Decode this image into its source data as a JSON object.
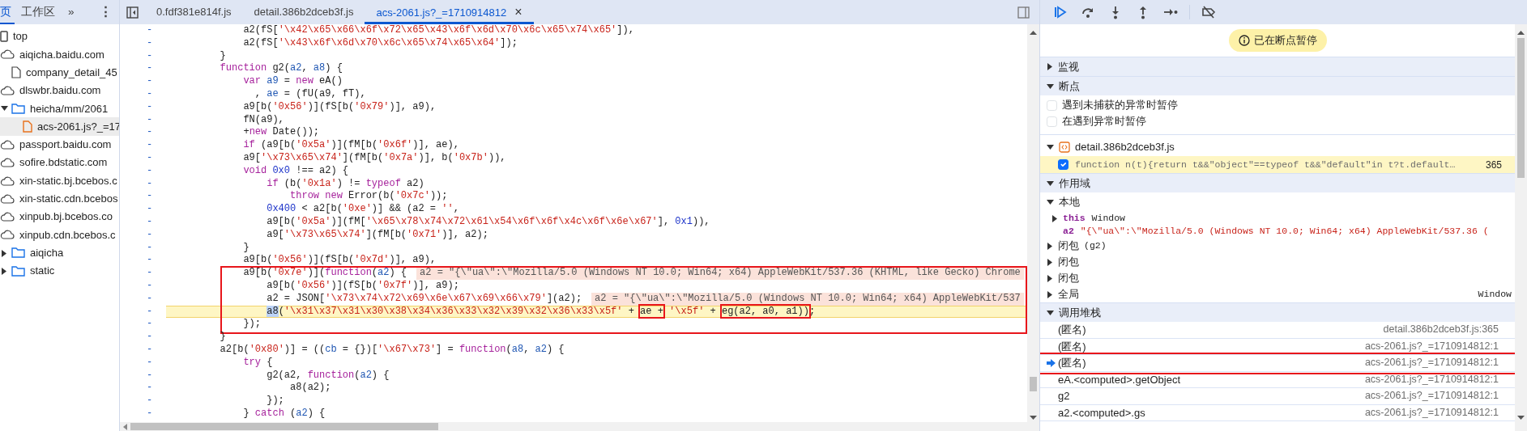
{
  "sidebar": {
    "tabs": [
      {
        "label": "页",
        "selected": true
      },
      {
        "label": "工作区",
        "selected": false
      }
    ],
    "more": "»",
    "menu": "⋮",
    "tree": [
      {
        "label": "top",
        "kind": "frame",
        "selected": false
      },
      {
        "label": "aiqicha.baidu.com",
        "kind": "domain",
        "selected": false,
        "children": [
          {
            "label": "company_detail_45",
            "kind": "file",
            "selected": false
          }
        ]
      },
      {
        "label": "dlswbr.baidu.com",
        "kind": "domain",
        "selected": false,
        "children": [
          {
            "label": "heicha/mm/2061",
            "kind": "folder",
            "expanded": true,
            "selected": false,
            "children": [
              {
                "label": "acs-2061.js?_=17",
                "kind": "script",
                "selected": true
              }
            ]
          }
        ]
      },
      {
        "label": "passport.baidu.com",
        "kind": "domain",
        "selected": false
      },
      {
        "label": "sofire.bdstatic.com",
        "kind": "domain",
        "selected": false
      },
      {
        "label": "xin-static.bj.bcebos.c",
        "kind": "domain",
        "selected": false
      },
      {
        "label": "xin-static.cdn.bcebos",
        "kind": "domain",
        "selected": false
      },
      {
        "label": "xinpub.bj.bcebos.co",
        "kind": "domain",
        "selected": false
      },
      {
        "label": "xinpub.cdn.bcebos.c",
        "kind": "domain",
        "selected": false,
        "children": [
          {
            "label": "aiqicha",
            "kind": "folder",
            "expanded": false,
            "selected": false
          },
          {
            "label": "static",
            "kind": "folder",
            "expanded": false,
            "selected": false
          }
        ]
      }
    ]
  },
  "editor": {
    "tabs": [
      {
        "label": "0.fdf381e814f.js",
        "selected": false
      },
      {
        "label": "detail.386b2dceb3f.js",
        "selected": false
      },
      {
        "label": "acs-2061.js?_=1710914812",
        "selected": true,
        "close": "×"
      }
    ]
  },
  "code": {
    "blocks": [
      {
        "boxed": false,
        "lines": [
          {
            "marker": "-",
            "current": false,
            "tokens": [
              {
                "kind": "plain",
                "text": "            a2(fS["
              },
              {
                "kind": "string",
                "text": "'\\x42\\x65\\x66\\x6f\\x72\\x65\\x43\\x6f\\x6d\\x70\\x6c\\x65\\x74\\x65'"
              },
              {
                "kind": "plain",
                "text": "]),"
              }
            ]
          },
          {
            "marker": "-",
            "current": false,
            "tokens": [
              {
                "kind": "plain",
                "text": "            a2(fS["
              },
              {
                "kind": "string",
                "text": "'\\x43\\x6f\\x6d\\x70\\x6c\\x65\\x74\\x65\\x64'"
              },
              {
                "kind": "plain",
                "text": "]);"
              }
            ]
          },
          {
            "marker": "-",
            "current": false,
            "tokens": [
              {
                "kind": "plain",
                "text": "        }"
              }
            ]
          },
          {
            "marker": "-",
            "current": false,
            "tokens": [
              {
                "kind": "keyword",
                "text": "        function"
              },
              {
                "kind": "plain",
                "text": " g2("
              },
              {
                "kind": "param",
                "text": "a2"
              },
              {
                "kind": "plain",
                "text": ", "
              },
              {
                "kind": "param",
                "text": "a8"
              },
              {
                "kind": "plain",
                "text": ") {"
              }
            ]
          },
          {
            "marker": "-",
            "current": false,
            "tokens": [
              {
                "kind": "keyword",
                "text": "            var"
              },
              {
                "kind": "param",
                "text": " a9"
              },
              {
                "kind": "plain",
                "text": " = "
              },
              {
                "kind": "keyword",
                "text": "new"
              },
              {
                "kind": "plain",
                "text": " eA()"
              }
            ]
          },
          {
            "marker": "-",
            "current": false,
            "tokens": [
              {
                "kind": "plain",
                "text": "              , "
              },
              {
                "kind": "param",
                "text": "ae"
              },
              {
                "kind": "plain",
                "text": " = (fU(a9, fT),"
              }
            ]
          },
          {
            "marker": "-",
            "current": false,
            "tokens": [
              {
                "kind": "plain",
                "text": "            a9[b("
              },
              {
                "kind": "string",
                "text": "'0x56'"
              },
              {
                "kind": "plain",
                "text": ")](fS[b("
              },
              {
                "kind": "string",
                "text": "'0x79'"
              },
              {
                "kind": "plain",
                "text": ")], a9),"
              }
            ]
          },
          {
            "marker": "-",
            "current": false,
            "tokens": [
              {
                "kind": "plain",
                "text": "            fN(a9),"
              }
            ]
          },
          {
            "marker": "-",
            "current": false,
            "tokens": [
              {
                "kind": "plain",
                "text": "            +"
              },
              {
                "kind": "keyword",
                "text": "new"
              },
              {
                "kind": "plain",
                "text": " Date());"
              }
            ]
          },
          {
            "marker": "-",
            "current": false,
            "tokens": [
              {
                "kind": "keyword",
                "text": "            if"
              },
              {
                "kind": "plain",
                "text": " (a9[b("
              },
              {
                "kind": "string",
                "text": "'0x5a'"
              },
              {
                "kind": "plain",
                "text": ")](fM[b("
              },
              {
                "kind": "string",
                "text": "'0x6f'"
              },
              {
                "kind": "plain",
                "text": ")], ae),"
              }
            ]
          },
          {
            "marker": "-",
            "current": false,
            "tokens": [
              {
                "kind": "plain",
                "text": "            a9["
              },
              {
                "kind": "string",
                "text": "'\\x73\\x65\\x74'"
              },
              {
                "kind": "plain",
                "text": "](fM[b("
              },
              {
                "kind": "string",
                "text": "'0x7a'"
              },
              {
                "kind": "plain",
                "text": ")], b("
              },
              {
                "kind": "string",
                "text": "'0x7b'"
              },
              {
                "kind": "plain",
                "text": ")),"
              }
            ]
          },
          {
            "marker": "-",
            "current": false,
            "tokens": [
              {
                "kind": "keyword",
                "text": "            void"
              },
              {
                "kind": "number",
                "text": " 0x0"
              },
              {
                "kind": "plain",
                "text": " !== a2) {"
              }
            ]
          },
          {
            "marker": "-",
            "current": false,
            "tokens": [
              {
                "kind": "keyword",
                "text": "                if"
              },
              {
                "kind": "plain",
                "text": " (b("
              },
              {
                "kind": "string",
                "text": "'0x1a'"
              },
              {
                "kind": "plain",
                "text": ") != "
              },
              {
                "kind": "keyword",
                "text": "typeof"
              },
              {
                "kind": "plain",
                "text": " a2)"
              }
            ]
          },
          {
            "marker": "-",
            "current": false,
            "tokens": [
              {
                "kind": "keyword",
                "text": "                    throw new"
              },
              {
                "kind": "plain",
                "text": " Error(b("
              },
              {
                "kind": "string",
                "text": "'0x7c'"
              },
              {
                "kind": "plain",
                "text": "));"
              }
            ]
          },
          {
            "marker": "-",
            "current": false,
            "tokens": [
              {
                "kind": "number",
                "text": "                0x400"
              },
              {
                "kind": "plain",
                "text": " < a2[b("
              },
              {
                "kind": "string",
                "text": "'0xe'"
              },
              {
                "kind": "plain",
                "text": ")] && (a2 = "
              },
              {
                "kind": "string",
                "text": "''"
              },
              {
                "kind": "plain",
                "text": ","
              }
            ]
          },
          {
            "marker": "-",
            "current": false,
            "tokens": [
              {
                "kind": "plain",
                "text": "                a9[b("
              },
              {
                "kind": "string",
                "text": "'0x5a'"
              },
              {
                "kind": "plain",
                "text": ")](fM["
              },
              {
                "kind": "string",
                "text": "'\\x65\\x78\\x74\\x72\\x61\\x54\\x6f\\x6f\\x4c\\x6f\\x6e\\x67'"
              },
              {
                "kind": "plain",
                "text": "], "
              },
              {
                "kind": "number",
                "text": "0x1"
              },
              {
                "kind": "plain",
                "text": ")),"
              }
            ]
          },
          {
            "marker": "-",
            "current": false,
            "tokens": [
              {
                "kind": "plain",
                "text": "                a9["
              },
              {
                "kind": "string",
                "text": "'\\x73\\x65\\x74'"
              },
              {
                "kind": "plain",
                "text": "](fM[b("
              },
              {
                "kind": "string",
                "text": "'0x71'"
              },
              {
                "kind": "plain",
                "text": ")], a2);"
              }
            ]
          },
          {
            "marker": "-",
            "current": false,
            "tokens": [
              {
                "kind": "plain",
                "text": "            }"
              }
            ]
          },
          {
            "marker": "-",
            "current": false,
            "tokens": [
              {
                "kind": "plain",
                "text": "            a9[b("
              },
              {
                "kind": "string",
                "text": "'0x56'"
              },
              {
                "kind": "plain",
                "text": ")](fS[b("
              },
              {
                "kind": "string",
                "text": "'0x7d'"
              },
              {
                "kind": "plain",
                "text": ")], a9),"
              }
            ]
          }
        ]
      },
      {
        "boxed": true,
        "lines": [
          {
            "marker": "-",
            "current": false,
            "tokens": [
              {
                "kind": "plain",
                "text": "            a9[b("
              },
              {
                "kind": "string",
                "text": "'0x7e'"
              },
              {
                "kind": "plain",
                "text": ")]("
              },
              {
                "kind": "keyword",
                "text": "function"
              },
              {
                "kind": "plain",
                "text": "("
              },
              {
                "kind": "param",
                "text": "a2"
              },
              {
                "kind": "plain",
                "text": ") {"
              }
            ],
            "inline_value": "a2 = \"{\\\"ua\\\":\\\"Mozilla/5.0 (Windows NT 10.0; Win64; x64) AppleWebKit/537.36 (KHTML, like Gecko) Chrome"
          },
          {
            "marker": "-",
            "current": false,
            "tokens": [
              {
                "kind": "plain",
                "text": "                a9[b("
              },
              {
                "kind": "string",
                "text": "'0x56'"
              },
              {
                "kind": "plain",
                "text": ")](fS[b("
              },
              {
                "kind": "string",
                "text": "'0x7f'"
              },
              {
                "kind": "plain",
                "text": ")], a9);"
              }
            ]
          },
          {
            "marker": "-",
            "current": false,
            "tokens": [
              {
                "kind": "plain",
                "text": "                a2 = JSON["
              },
              {
                "kind": "string",
                "text": "'\\x73\\x74\\x72\\x69\\x6e\\x67\\x69\\x66\\x79'"
              },
              {
                "kind": "plain",
                "text": "](a2);"
              }
            ],
            "inline_value": "a2 = \"{\\\"ua\\\":\\\"Mozilla/5.0 (Windows NT 10.0; Win64; x64) AppleWebKit/537"
          },
          {
            "marker": "-",
            "current": true,
            "tokens": [
              {
                "kind": "selected",
                "text": "a8"
              },
              {
                "kind": "plain",
                "text": "("
              },
              {
                "kind": "string",
                "text": "'\\x31\\x37\\x31\\x30\\x38\\x34\\x36\\x33\\x32\\x39\\x32\\x36\\x33\\x5f'"
              },
              {
                "kind": "plain",
                "text": " + "
              },
              {
                "kind": "marked",
                "text": "ae +"
              },
              {
                "kind": "string",
                "text": " '\\x5f'"
              },
              {
                "kind": "plain",
                "text": " + "
              },
              {
                "kind": "marked",
                "text": "eg(a2, a0, a1))"
              },
              {
                "kind": "plain",
                "text": ";"
              }
            ]
          },
          {
            "marker": "-",
            "current": false,
            "tokens": [
              {
                "kind": "plain",
                "text": "            });"
              }
            ]
          }
        ]
      },
      {
        "boxed": false,
        "lines": [
          {
            "marker": "-",
            "current": false,
            "tokens": [
              {
                "kind": "plain",
                "text": "        }"
              }
            ]
          },
          {
            "marker": "-",
            "current": false,
            "tokens": [
              {
                "kind": "plain",
                "text": "        a2[b("
              },
              {
                "kind": "string",
                "text": "'0x80'"
              },
              {
                "kind": "plain",
                "text": ")] = (("
              },
              {
                "kind": "param",
                "text": "cb"
              },
              {
                "kind": "plain",
                "text": " = {})["
              },
              {
                "kind": "string",
                "text": "'\\x67\\x73'"
              },
              {
                "kind": "plain",
                "text": "] = "
              },
              {
                "kind": "keyword",
                "text": "function"
              },
              {
                "kind": "plain",
                "text": "("
              },
              {
                "kind": "param",
                "text": "a8"
              },
              {
                "kind": "plain",
                "text": ", "
              },
              {
                "kind": "param",
                "text": "a2"
              },
              {
                "kind": "plain",
                "text": ") {"
              }
            ]
          },
          {
            "marker": "-",
            "current": false,
            "tokens": [
              {
                "kind": "keyword",
                "text": "            try"
              },
              {
                "kind": "plain",
                "text": " {"
              }
            ]
          },
          {
            "marker": "-",
            "current": false,
            "tokens": [
              {
                "kind": "plain",
                "text": "                g2(a2, "
              },
              {
                "kind": "keyword",
                "text": "function"
              },
              {
                "kind": "plain",
                "text": "("
              },
              {
                "kind": "param",
                "text": "a2"
              },
              {
                "kind": "plain",
                "text": ") {"
              }
            ]
          },
          {
            "marker": "-",
            "current": false,
            "tokens": [
              {
                "kind": "plain",
                "text": "                    a8(a2);"
              }
            ]
          },
          {
            "marker": "-",
            "current": false,
            "tokens": [
              {
                "kind": "plain",
                "text": "                });"
              }
            ]
          },
          {
            "marker": "-",
            "current": false,
            "tokens": [
              {
                "kind": "plain",
                "text": "            } "
              },
              {
                "kind": "keyword",
                "text": "catch"
              },
              {
                "kind": "plain",
                "text": " ("
              },
              {
                "kind": "param",
                "text": "a2"
              },
              {
                "kind": "plain",
                "text": ") {"
              }
            ]
          }
        ]
      }
    ]
  },
  "debugger": {
    "paused_banner": "已在断点暂停",
    "watch": {
      "title": "监视",
      "expanded": false
    },
    "breakpoints": {
      "title": "断点",
      "expanded": true,
      "options": [
        {
          "label": "遇到未捕获的异常时暂停",
          "checked": false
        },
        {
          "label": "在遇到异常时暂停",
          "checked": false
        }
      ],
      "files": [
        {
          "name": "detail.386b2dceb3f.js",
          "expanded": true,
          "items": [
            {
              "code": "function n(t){return t&&\"object\"==typeof t&&\"default\"in t?t.default…",
              "line": "365",
              "checked": true
            }
          ]
        }
      ]
    },
    "scope": {
      "title": "作用域",
      "expanded": true,
      "groups": [
        {
          "title": "本地",
          "expanded": true,
          "vars": [
            {
              "name": "this",
              "value": "Window",
              "kind": "object",
              "expanded": false
            },
            {
              "name": "a2",
              "value": "\"{\\\"ua\\\":\\\"Mozilla/5.0 (Windows NT 10.0; Win64; x64) AppleWebKit/537.36 (",
              "kind": "string"
            }
          ]
        },
        {
          "title": "闭包",
          "detail": "(g2)",
          "expanded": false
        },
        {
          "title": "闭包",
          "expanded": false
        },
        {
          "title": "闭包",
          "expanded": false
        },
        {
          "title": "全局",
          "value": "Window",
          "expanded": false
        }
      ]
    },
    "call_stack": {
      "title": "调用堆栈",
      "expanded": true,
      "frames": [
        {
          "name": "(匿名)",
          "location": "detail.386b2dceb3f.js:365",
          "selected": false,
          "boxed": false
        },
        {
          "name": "(匿名)",
          "location": "acs-2061.js?_=1710914812:1",
          "selected": false,
          "boxed": false
        },
        {
          "name": "(匿名)",
          "location": "acs-2061.js?_=1710914812:1",
          "selected": true,
          "boxed": true
        },
        {
          "name": "eA.<computed>.getObject",
          "location": "acs-2061.js?_=1710914812:1",
          "selected": false,
          "boxed": false
        },
        {
          "name": "g2",
          "location": "acs-2061.js?_=1710914812:1",
          "selected": false,
          "boxed": false
        },
        {
          "name": "a2.<computed>.gs",
          "location": "acs-2061.js?_=1710914812:1",
          "selected": false,
          "boxed": false
        }
      ]
    }
  }
}
